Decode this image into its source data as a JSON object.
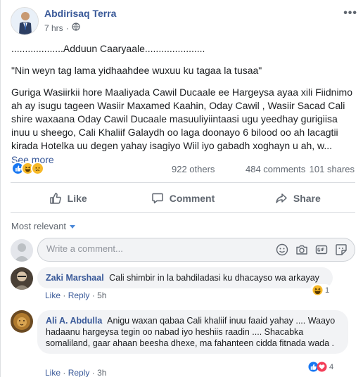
{
  "post": {
    "author": "Abdirisaq Terra",
    "time": "7 hrs",
    "dots": "•••",
    "line1": "...................Adduun Caaryaale......................",
    "line2": "\"Nin weyn tag lama yidhaahdee wuxuu ku tagaa la tusaa\"",
    "body": "Guriga Wasiirkii hore Maaliyada Cawil Ducaale ee Hargeysa ayaa xili Fiidnimo ah ay isugu tageen Wasiir Maxamed Kaahin, Oday Cawil , Wasiir Sacad Cali shire waxaana Oday Cawil Ducaale masuuliyiintaasi ugu yeedhay gurigiisa inuu u sheego, Cali Khaliif Galaydh oo laga doonayo 6 bilood oo ah lacagtii kirada Hotelka uu degen yahay isagiyo Wiil iyo gabadh xoghayn u ah, w...",
    "see_more": "See more"
  },
  "stats": {
    "others": "922 others",
    "comments": "484 comments",
    "shares": "101 shares"
  },
  "actions": {
    "like": "Like",
    "comment": "Comment",
    "share": "Share"
  },
  "sort_label": "Most relevant",
  "composer": {
    "placeholder": "Write a comment..."
  },
  "comments": [
    {
      "name": "Zaki Marshaal",
      "text": "Cali shimbir in la bahdiladasi ku dhacayso wa arkayay",
      "like": "Like",
      "reply": "Reply",
      "time": "5h",
      "sep": "·",
      "react_count": "1"
    },
    {
      "name": "Ali A. Abdulla",
      "text": "Anigu waxan qabaa Cali khaliif inuu faaid yahay .... Waayo hadaanu hargeysa tegin oo nabad iyo heshiis raadin .... Shacabka somaliland, gaar ahaan beesha dhexe, ma fahanteen cidda fitnada wada .",
      "like": "Like",
      "reply": "Reply",
      "time": "3h",
      "sep": "·",
      "react_count": "4"
    }
  ],
  "colors": {
    "link": "#385898",
    "like_blue": "#1877f2",
    "haha_yellow": "#f7b928",
    "love_red": "#f33e58"
  }
}
